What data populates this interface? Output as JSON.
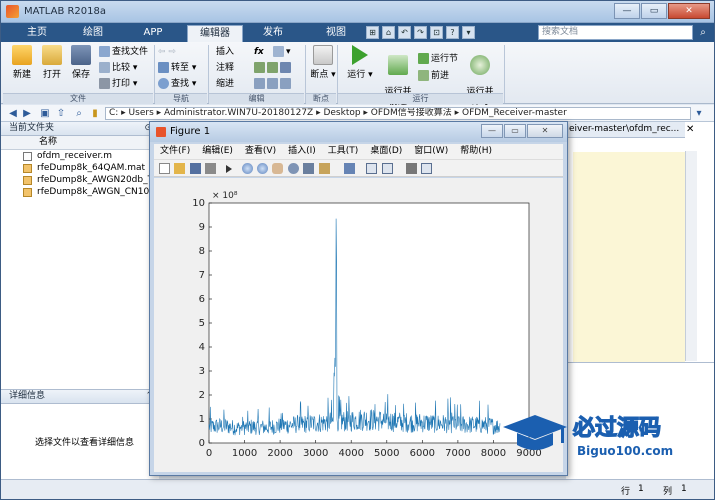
{
  "window": {
    "title": "MATLAB R2018a",
    "btn_min": "—",
    "btn_max": "▭",
    "btn_close": "✕"
  },
  "tabs": [
    "主页",
    "绘图",
    "APP",
    "编辑器",
    "发布",
    "视图"
  ],
  "tab_icons": [
    "⊞",
    "⌂",
    "↶",
    "↷",
    "⊡",
    "?",
    "▾"
  ],
  "search": {
    "placeholder": "搜索文档",
    "icon": "⌕"
  },
  "ribbon": {
    "file": {
      "new": "新建",
      "open": "打开",
      "save": "保存",
      "find_files": "查找文件",
      "compare": "比较",
      "print": "打印",
      "group": "文件"
    },
    "nav": {
      "goto": "转至",
      "find": "查找",
      "group": "导航"
    },
    "edit": {
      "insert": "插入",
      "comment": "注释",
      "indent": "缩进",
      "fx": "fx",
      "group": "编辑"
    },
    "breakpoints": {
      "label": "断点",
      "group": "断点"
    },
    "run": {
      "run": "运行",
      "run_advance": "运行并\n前进",
      "run_section": "运行节",
      "advance": "前进",
      "run_time": "运行并\n计时",
      "group": "运行"
    }
  },
  "address": {
    "path": "C: ▸ Users ▸ Administrator.WIN7U-20180127Z ▸ Desktop ▸ OFDM信号接收算法 ▸ OFDM_Receiver-master",
    "arrow": "▾"
  },
  "current_folder": {
    "title": "当前文件夹",
    "column": "名称",
    "files": [
      "ofdm_receiver.m",
      "rfeDump8k_64QAM.mat",
      "rfeDump8k_AWGN20db_TU",
      "rfeDump8k_AWGN_CN10d"
    ]
  },
  "details": {
    "title": "详细信息",
    "message": "选择文件以查看详细信息"
  },
  "editor_tab": "eiver-master\\ofdm_rec...",
  "status": {
    "row_label": "行",
    "row": "1",
    "col_label": "列",
    "col": "1"
  },
  "figure": {
    "title": "Figure 1",
    "menus": [
      "文件(F)",
      "编辑(E)",
      "查看(V)",
      "插入(I)",
      "工具(T)",
      "桌面(D)",
      "窗口(W)",
      "帮助(H)"
    ],
    "btn_min": "—",
    "btn_max": "▭",
    "btn_close": "✕"
  },
  "chart_data": {
    "type": "line",
    "title": "",
    "xlabel": "",
    "ylabel": "",
    "exponent_label": "× 10⁸",
    "xlim": [
      0,
      9000
    ],
    "ylim": [
      0,
      10
    ],
    "xticks": [
      0,
      1000,
      2000,
      3000,
      4000,
      5000,
      6000,
      7000,
      8000,
      9000
    ],
    "yticks": [
      0,
      1,
      2,
      3,
      4,
      5,
      6,
      7,
      8,
      9,
      10
    ],
    "color": "#1f77b4",
    "series": [
      {
        "x": [
          0,
          400,
          800,
          1200,
          1600,
          2000,
          2400,
          2800,
          3200,
          3500,
          3580,
          3600,
          3700,
          4000,
          4400,
          4800,
          5200,
          5600,
          6000,
          6400,
          6800,
          7200,
          7600,
          8000,
          8192
        ],
        "values": [
          0.75,
          0.8,
          0.7,
          0.75,
          0.72,
          0.8,
          0.85,
          0.9,
          0.95,
          1.0,
          9.35,
          1.1,
          1.0,
          1.05,
          1.1,
          1.05,
          1.0,
          0.95,
          0.95,
          0.9,
          0.9,
          0.85,
          0.85,
          0.8,
          0.75
        ],
        "noise_amplitude": 0.6
      }
    ]
  },
  "watermark": {
    "text": "必过源码",
    "url": "Biguo100.com"
  }
}
